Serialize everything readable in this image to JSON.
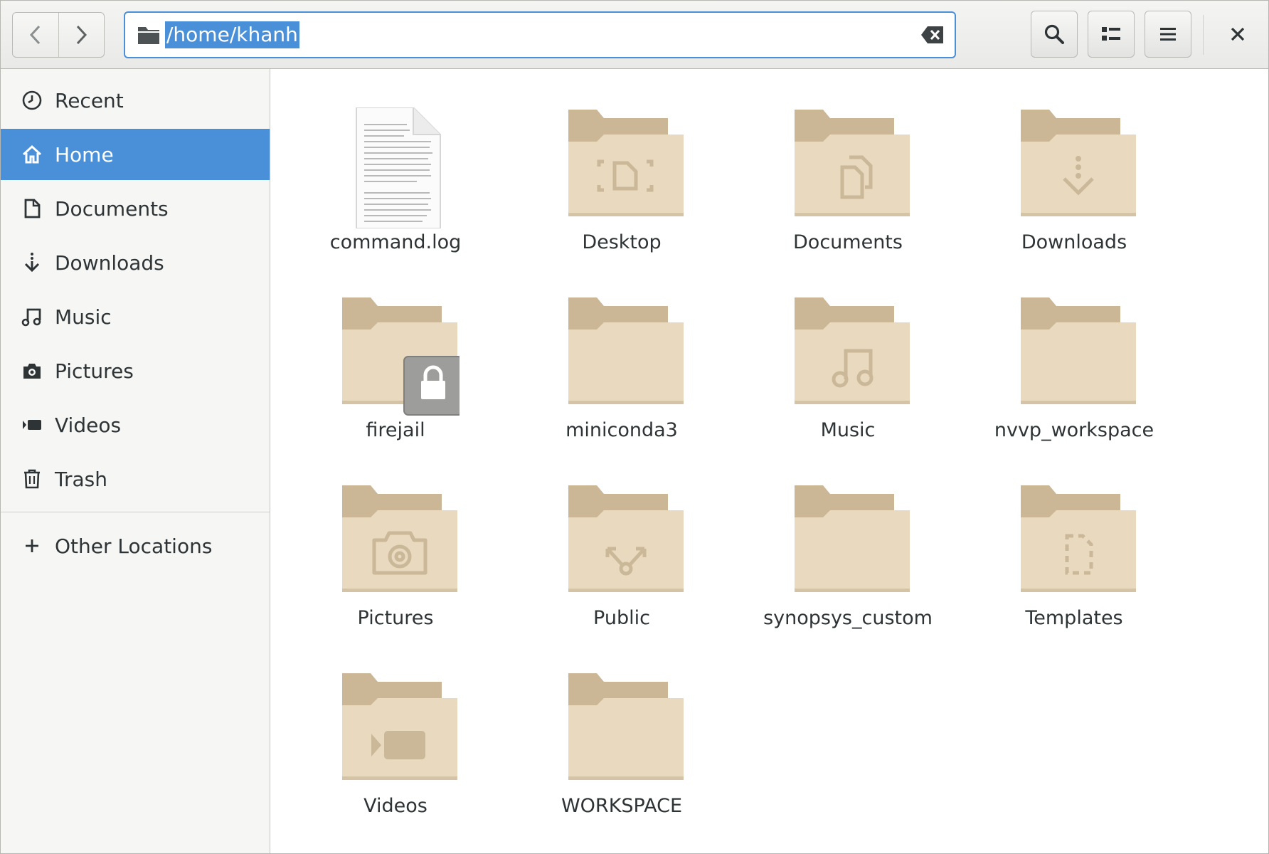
{
  "header": {
    "location_path": "/home/khanh",
    "back_icon": "chevron-left-icon",
    "forward_icon": "chevron-right-icon",
    "search_icon": "search-icon",
    "view_icon": "list-view-icon",
    "menu_icon": "hamburger-menu-icon",
    "close_icon": "close-icon",
    "accent_color": "#4a90d9"
  },
  "sidebar": {
    "items": [
      {
        "label": "Recent",
        "icon": "clock-icon"
      },
      {
        "label": "Home",
        "icon": "home-icon",
        "active": true
      },
      {
        "label": "Documents",
        "icon": "document-icon"
      },
      {
        "label": "Downloads",
        "icon": "download-icon"
      },
      {
        "label": "Music",
        "icon": "music-icon"
      },
      {
        "label": "Pictures",
        "icon": "camera-icon"
      },
      {
        "label": "Videos",
        "icon": "video-icon"
      },
      {
        "label": "Trash",
        "icon": "trash-icon"
      },
      {
        "label": "Other Locations",
        "icon": "plus-icon"
      }
    ]
  },
  "files": [
    {
      "name": "command.log",
      "type": "text-file"
    },
    {
      "name": "Desktop",
      "type": "folder",
      "emblem": "desktop"
    },
    {
      "name": "Documents",
      "type": "folder",
      "emblem": "documents"
    },
    {
      "name": "Downloads",
      "type": "folder",
      "emblem": "download"
    },
    {
      "name": "firejail",
      "type": "folder",
      "emblem": "lock"
    },
    {
      "name": "miniconda3",
      "type": "folder",
      "emblem": "none"
    },
    {
      "name": "Music",
      "type": "folder",
      "emblem": "music"
    },
    {
      "name": "nvvp_workspace",
      "type": "folder",
      "emblem": "none"
    },
    {
      "name": "Pictures",
      "type": "folder",
      "emblem": "camera"
    },
    {
      "name": "Public",
      "type": "folder",
      "emblem": "share"
    },
    {
      "name": "synopsys_custom",
      "type": "folder",
      "emblem": "none"
    },
    {
      "name": "Templates",
      "type": "folder",
      "emblem": "template"
    },
    {
      "name": "Videos",
      "type": "folder",
      "emblem": "video"
    },
    {
      "name": "WORKSPACE",
      "type": "folder",
      "emblem": "none"
    }
  ]
}
